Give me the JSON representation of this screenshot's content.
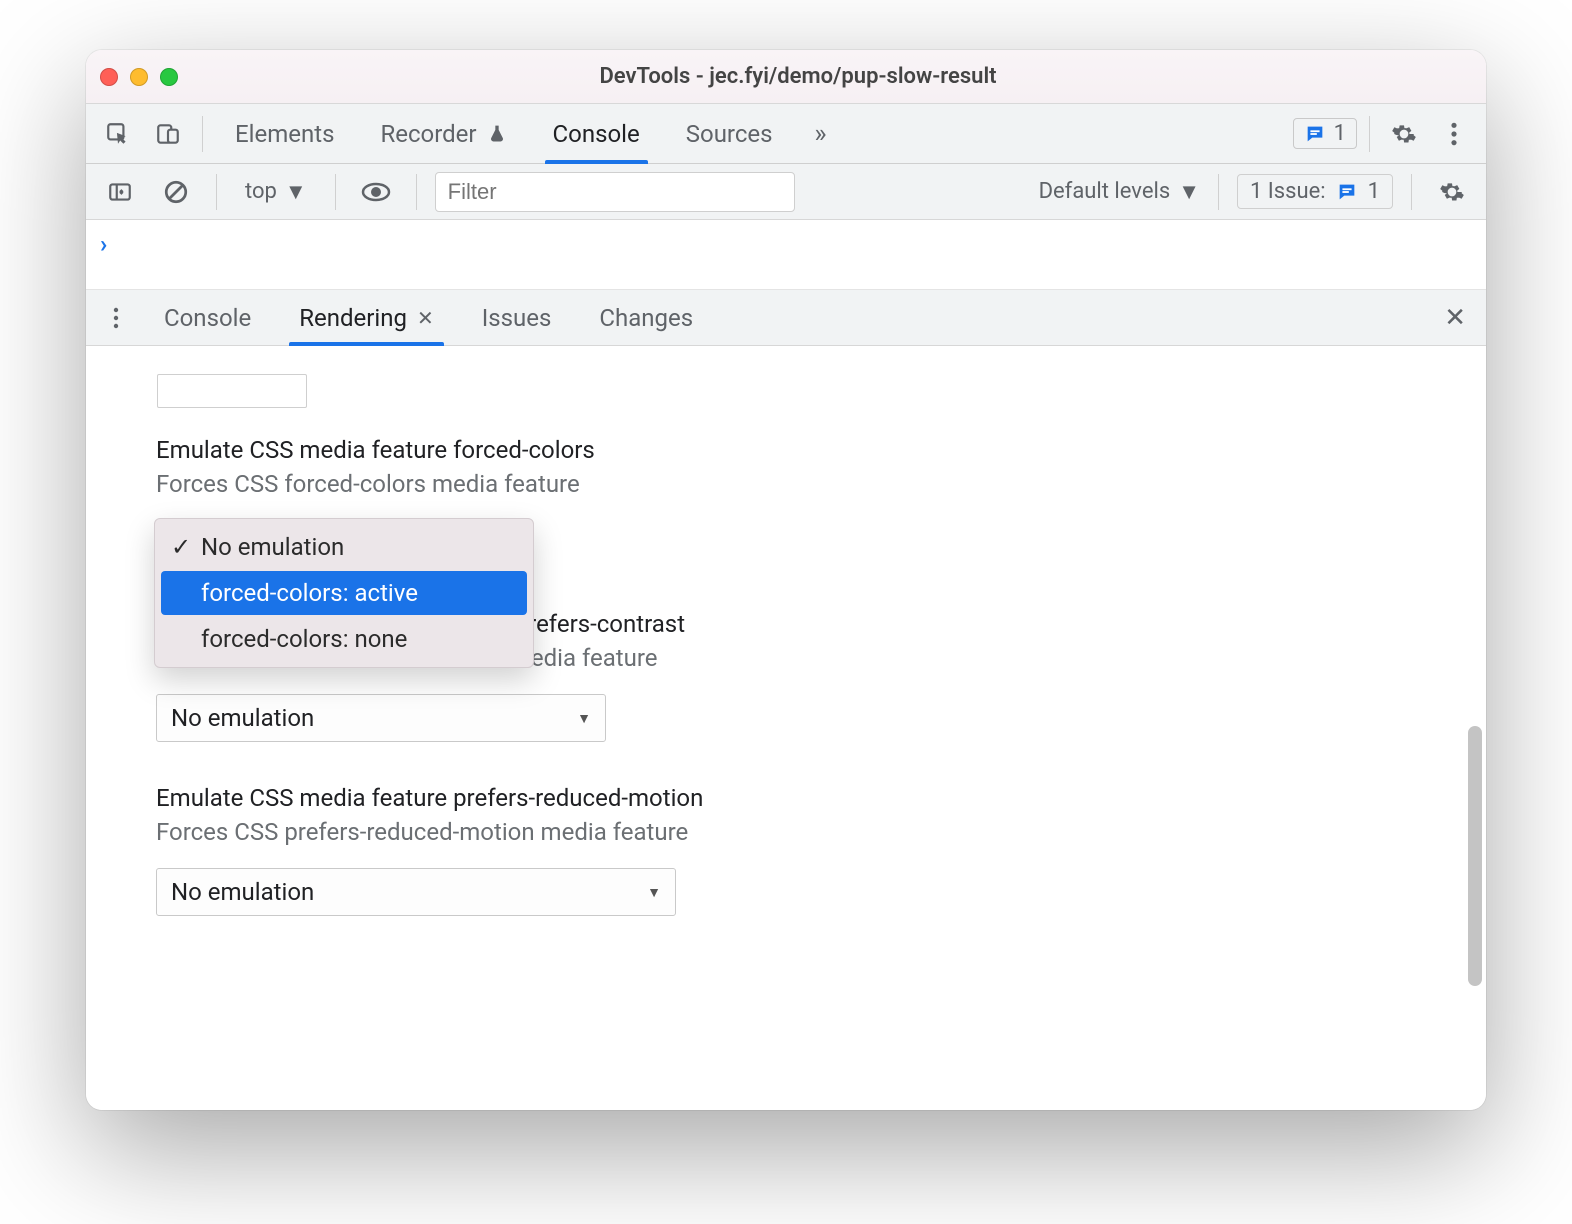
{
  "window": {
    "title": "DevTools - jec.fyi/demo/pup-slow-result"
  },
  "mainTabs": {
    "items": [
      "Elements",
      "Recorder",
      "Console",
      "Sources"
    ],
    "activeIndex": 2,
    "issueBadge": "1"
  },
  "consoleBar": {
    "context": "top",
    "filterPlaceholder": "Filter",
    "levels": "Default levels",
    "issueLabel": "1 Issue:",
    "issueCount": "1"
  },
  "drawer": {
    "tabs": [
      "Console",
      "Rendering",
      "Issues",
      "Changes"
    ],
    "activeIndex": 1
  },
  "rendering": {
    "sections": [
      {
        "title": "Emulate CSS media feature forced-colors",
        "desc": "Forces CSS forced-colors media feature",
        "value": "No emulation",
        "options": [
          "No emulation",
          "forced-colors: active",
          "forced-colors: none"
        ],
        "open": true,
        "highlightIndex": 1,
        "checkedIndex": 0
      },
      {
        "title": "Emulate CSS media feature prefers-contrast",
        "desc": "Forces CSS prefers-contrast media feature",
        "titleObscuredSuffix": "e prefers-contrast",
        "descObscuredSuffix": "t media feature",
        "value": "No emulation"
      },
      {
        "title": "Emulate CSS media feature prefers-reduced-motion",
        "desc": "Forces CSS prefers-reduced-motion media feature",
        "value": "No emulation"
      }
    ]
  }
}
